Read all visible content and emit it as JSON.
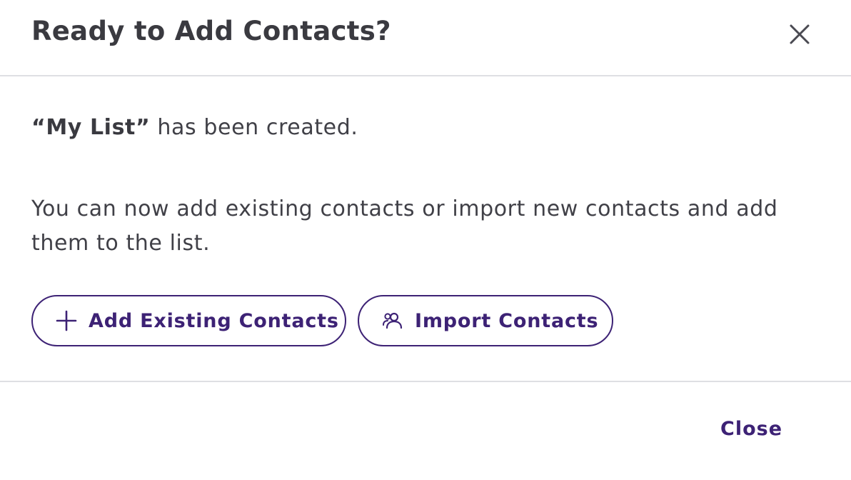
{
  "dialog": {
    "title": "Ready to Add Contacts?",
    "close_icon": "close-icon"
  },
  "body": {
    "list_name_quoted": "“My List”",
    "created_suffix": " has been created.",
    "description": "You can now add existing contacts or import new contacts and add them to the list."
  },
  "actions": {
    "add_existing": {
      "label": "Add Existing Contacts",
      "icon": "plus-icon"
    },
    "import": {
      "label": "Import Contacts",
      "icon": "people-icon"
    }
  },
  "footer": {
    "close_label": "Close"
  },
  "colors": {
    "accent": "#3d2275",
    "text": "#3f3f46",
    "divider": "#dedfe3"
  }
}
